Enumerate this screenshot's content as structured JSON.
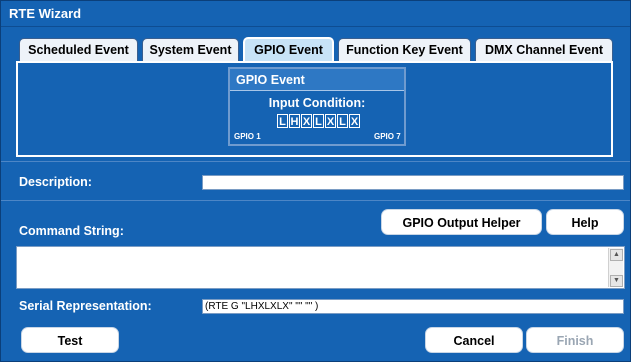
{
  "window": {
    "title": "RTE Wizard"
  },
  "tabs": [
    {
      "label": "Scheduled Event",
      "active": false
    },
    {
      "label": "System Event",
      "active": false
    },
    {
      "label": "GPIO Event",
      "active": true
    },
    {
      "label": "Function Key Event",
      "active": false
    },
    {
      "label": "DMX Channel Event",
      "active": false
    }
  ],
  "gpio_panel": {
    "header": "GPIO Event",
    "condition_label": "Input Condition:",
    "cells": [
      "L",
      "H",
      "X",
      "L",
      "X",
      "L",
      "X"
    ],
    "left_label": "GPIO 1",
    "right_label": "GPIO 7"
  },
  "description": {
    "label": "Description:",
    "value": ""
  },
  "command": {
    "label": "Command String:",
    "helper_button": "GPIO Output Helper",
    "help_button": "Help",
    "value": ""
  },
  "serial": {
    "label": "Serial Representation:",
    "value": "(RTE G \"LHXLXLX\" \"\" \"\" )"
  },
  "footer": {
    "test_button": "Test",
    "cancel_button": "Cancel",
    "finish_button": "Finish"
  }
}
